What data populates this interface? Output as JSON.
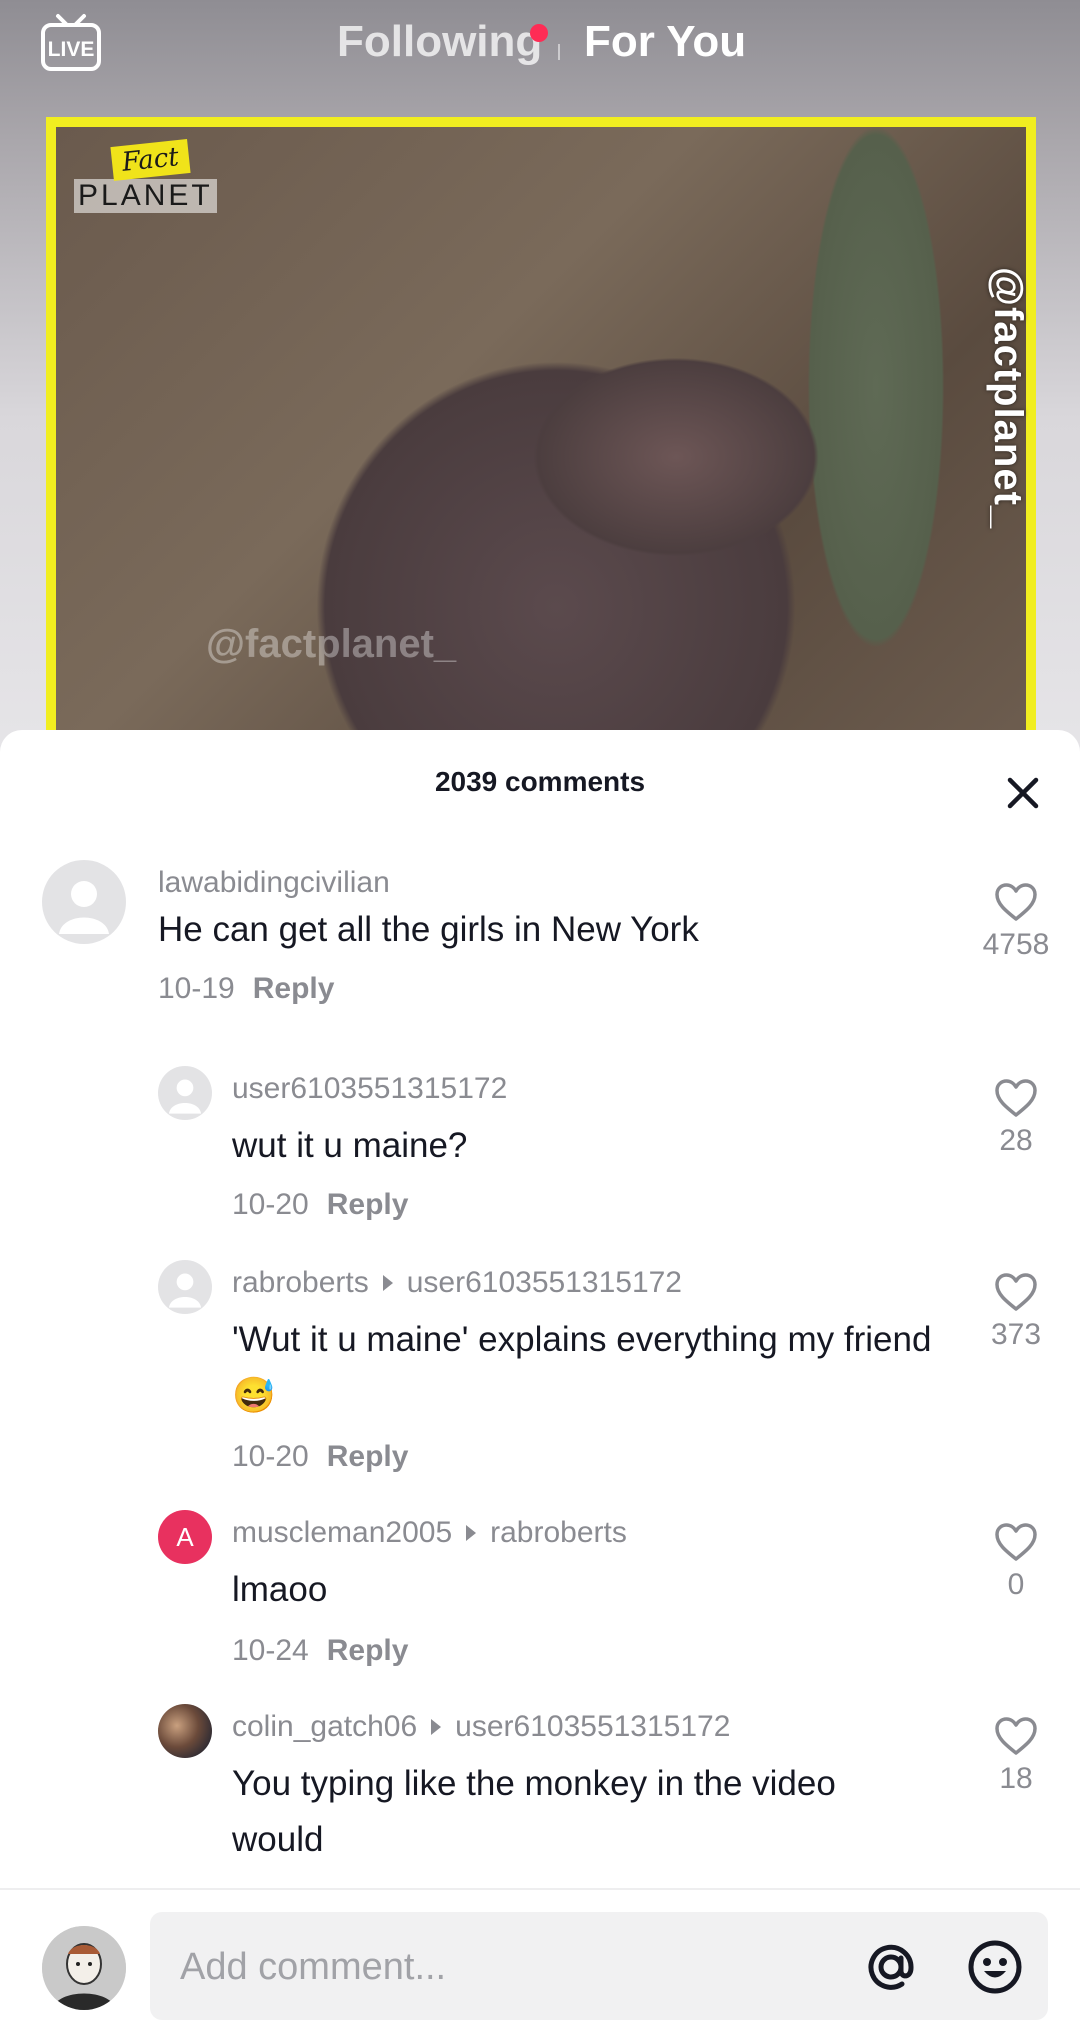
{
  "header": {
    "live_label": "LIVE",
    "tab_following": "Following",
    "tab_for_you": "For You"
  },
  "video": {
    "logo_top": "Fact",
    "logo_bottom": "PLANET",
    "vertical_handle": "@factplanet_",
    "watermark": "@factplanet_"
  },
  "comments_panel": {
    "title": "2039 comments",
    "items": [
      {
        "username": "lawabidingcivilian",
        "reply_to": "",
        "text": "He can get all the girls in New York",
        "date": "10-19",
        "reply_label": "Reply",
        "likes": "4758",
        "avatar": "placeholder"
      },
      {
        "username": "user6103551315172",
        "reply_to": "",
        "text": "wut it u maine?",
        "date": "10-20",
        "reply_label": "Reply",
        "likes": "28",
        "avatar": "placeholder"
      },
      {
        "username": "rabroberts",
        "reply_to": "user6103551315172",
        "text": "'Wut it u maine' explains everything my friend 😅",
        "date": "10-20",
        "reply_label": "Reply",
        "likes": "373",
        "avatar": "placeholder"
      },
      {
        "username": "muscleman2005",
        "reply_to": "rabroberts",
        "text": "lmaoo",
        "date": "10-24",
        "reply_label": "Reply",
        "likes": "0",
        "avatar": "letter",
        "avatar_letter": "A"
      },
      {
        "username": "colin_gatch06",
        "reply_to": "user6103551315172",
        "text": "You typing like the monkey in the video would",
        "date": "",
        "reply_label": "",
        "likes": "18",
        "avatar": "photo"
      }
    ]
  },
  "composer": {
    "placeholder": "Add comment..."
  },
  "colors": {
    "accent": "#fe2c55",
    "photo_border": "#f1ee20",
    "secondary_text": "#8a8b91",
    "primary_text": "#161823"
  }
}
